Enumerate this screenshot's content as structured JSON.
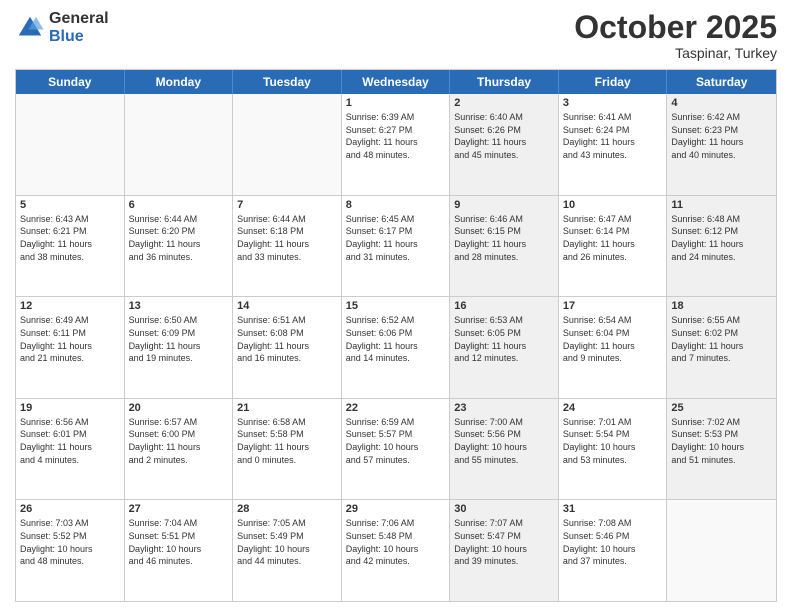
{
  "logo": {
    "general": "General",
    "blue": "Blue"
  },
  "header": {
    "month": "October 2025",
    "location": "Taspinar, Turkey"
  },
  "weekdays": [
    "Sunday",
    "Monday",
    "Tuesday",
    "Wednesday",
    "Thursday",
    "Friday",
    "Saturday"
  ],
  "rows": [
    [
      {
        "day": "",
        "text": "",
        "shaded": false,
        "empty": true
      },
      {
        "day": "",
        "text": "",
        "shaded": false,
        "empty": true
      },
      {
        "day": "",
        "text": "",
        "shaded": false,
        "empty": true
      },
      {
        "day": "1",
        "text": "Sunrise: 6:39 AM\nSunset: 6:27 PM\nDaylight: 11 hours\nand 48 minutes.",
        "shaded": false,
        "empty": false
      },
      {
        "day": "2",
        "text": "Sunrise: 6:40 AM\nSunset: 6:26 PM\nDaylight: 11 hours\nand 45 minutes.",
        "shaded": true,
        "empty": false
      },
      {
        "day": "3",
        "text": "Sunrise: 6:41 AM\nSunset: 6:24 PM\nDaylight: 11 hours\nand 43 minutes.",
        "shaded": false,
        "empty": false
      },
      {
        "day": "4",
        "text": "Sunrise: 6:42 AM\nSunset: 6:23 PM\nDaylight: 11 hours\nand 40 minutes.",
        "shaded": true,
        "empty": false
      }
    ],
    [
      {
        "day": "5",
        "text": "Sunrise: 6:43 AM\nSunset: 6:21 PM\nDaylight: 11 hours\nand 38 minutes.",
        "shaded": false,
        "empty": false
      },
      {
        "day": "6",
        "text": "Sunrise: 6:44 AM\nSunset: 6:20 PM\nDaylight: 11 hours\nand 36 minutes.",
        "shaded": false,
        "empty": false
      },
      {
        "day": "7",
        "text": "Sunrise: 6:44 AM\nSunset: 6:18 PM\nDaylight: 11 hours\nand 33 minutes.",
        "shaded": false,
        "empty": false
      },
      {
        "day": "8",
        "text": "Sunrise: 6:45 AM\nSunset: 6:17 PM\nDaylight: 11 hours\nand 31 minutes.",
        "shaded": false,
        "empty": false
      },
      {
        "day": "9",
        "text": "Sunrise: 6:46 AM\nSunset: 6:15 PM\nDaylight: 11 hours\nand 28 minutes.",
        "shaded": true,
        "empty": false
      },
      {
        "day": "10",
        "text": "Sunrise: 6:47 AM\nSunset: 6:14 PM\nDaylight: 11 hours\nand 26 minutes.",
        "shaded": false,
        "empty": false
      },
      {
        "day": "11",
        "text": "Sunrise: 6:48 AM\nSunset: 6:12 PM\nDaylight: 11 hours\nand 24 minutes.",
        "shaded": true,
        "empty": false
      }
    ],
    [
      {
        "day": "12",
        "text": "Sunrise: 6:49 AM\nSunset: 6:11 PM\nDaylight: 11 hours\nand 21 minutes.",
        "shaded": false,
        "empty": false
      },
      {
        "day": "13",
        "text": "Sunrise: 6:50 AM\nSunset: 6:09 PM\nDaylight: 11 hours\nand 19 minutes.",
        "shaded": false,
        "empty": false
      },
      {
        "day": "14",
        "text": "Sunrise: 6:51 AM\nSunset: 6:08 PM\nDaylight: 11 hours\nand 16 minutes.",
        "shaded": false,
        "empty": false
      },
      {
        "day": "15",
        "text": "Sunrise: 6:52 AM\nSunset: 6:06 PM\nDaylight: 11 hours\nand 14 minutes.",
        "shaded": false,
        "empty": false
      },
      {
        "day": "16",
        "text": "Sunrise: 6:53 AM\nSunset: 6:05 PM\nDaylight: 11 hours\nand 12 minutes.",
        "shaded": true,
        "empty": false
      },
      {
        "day": "17",
        "text": "Sunrise: 6:54 AM\nSunset: 6:04 PM\nDaylight: 11 hours\nand 9 minutes.",
        "shaded": false,
        "empty": false
      },
      {
        "day": "18",
        "text": "Sunrise: 6:55 AM\nSunset: 6:02 PM\nDaylight: 11 hours\nand 7 minutes.",
        "shaded": true,
        "empty": false
      }
    ],
    [
      {
        "day": "19",
        "text": "Sunrise: 6:56 AM\nSunset: 6:01 PM\nDaylight: 11 hours\nand 4 minutes.",
        "shaded": false,
        "empty": false
      },
      {
        "day": "20",
        "text": "Sunrise: 6:57 AM\nSunset: 6:00 PM\nDaylight: 11 hours\nand 2 minutes.",
        "shaded": false,
        "empty": false
      },
      {
        "day": "21",
        "text": "Sunrise: 6:58 AM\nSunset: 5:58 PM\nDaylight: 11 hours\nand 0 minutes.",
        "shaded": false,
        "empty": false
      },
      {
        "day": "22",
        "text": "Sunrise: 6:59 AM\nSunset: 5:57 PM\nDaylight: 10 hours\nand 57 minutes.",
        "shaded": false,
        "empty": false
      },
      {
        "day": "23",
        "text": "Sunrise: 7:00 AM\nSunset: 5:56 PM\nDaylight: 10 hours\nand 55 minutes.",
        "shaded": true,
        "empty": false
      },
      {
        "day": "24",
        "text": "Sunrise: 7:01 AM\nSunset: 5:54 PM\nDaylight: 10 hours\nand 53 minutes.",
        "shaded": false,
        "empty": false
      },
      {
        "day": "25",
        "text": "Sunrise: 7:02 AM\nSunset: 5:53 PM\nDaylight: 10 hours\nand 51 minutes.",
        "shaded": true,
        "empty": false
      }
    ],
    [
      {
        "day": "26",
        "text": "Sunrise: 7:03 AM\nSunset: 5:52 PM\nDaylight: 10 hours\nand 48 minutes.",
        "shaded": false,
        "empty": false
      },
      {
        "day": "27",
        "text": "Sunrise: 7:04 AM\nSunset: 5:51 PM\nDaylight: 10 hours\nand 46 minutes.",
        "shaded": false,
        "empty": false
      },
      {
        "day": "28",
        "text": "Sunrise: 7:05 AM\nSunset: 5:49 PM\nDaylight: 10 hours\nand 44 minutes.",
        "shaded": false,
        "empty": false
      },
      {
        "day": "29",
        "text": "Sunrise: 7:06 AM\nSunset: 5:48 PM\nDaylight: 10 hours\nand 42 minutes.",
        "shaded": false,
        "empty": false
      },
      {
        "day": "30",
        "text": "Sunrise: 7:07 AM\nSunset: 5:47 PM\nDaylight: 10 hours\nand 39 minutes.",
        "shaded": true,
        "empty": false
      },
      {
        "day": "31",
        "text": "Sunrise: 7:08 AM\nSunset: 5:46 PM\nDaylight: 10 hours\nand 37 minutes.",
        "shaded": false,
        "empty": false
      },
      {
        "day": "",
        "text": "",
        "shaded": true,
        "empty": true
      }
    ]
  ]
}
